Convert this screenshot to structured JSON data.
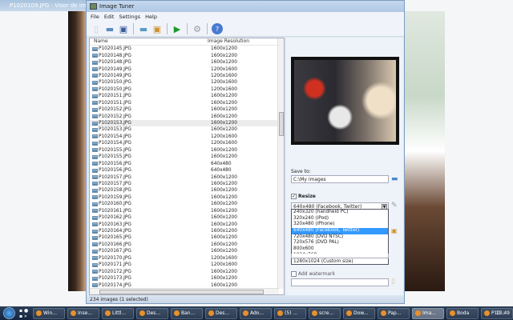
{
  "background_window": {
    "title": "P1020109.JPG - Visor de imágenes"
  },
  "window": {
    "title": "Image Tuner"
  },
  "menu": [
    "File",
    "Edit",
    "Settings",
    "Help"
  ],
  "toolbar": [
    "new-icon",
    "open-folder-icon",
    "save-icon",
    "add-folder-icon",
    "add-images-icon",
    "run-icon",
    "settings-gears-icon",
    "help-icon"
  ],
  "list": {
    "columns": [
      "Name",
      "Image Resolution"
    ],
    "rows": [
      [
        "P1020145.JPG",
        "1600x1200"
      ],
      [
        "P1020148.JPG",
        "1600x1200"
      ],
      [
        "P1020148.JPG",
        "1600x1200"
      ],
      [
        "P1020149.JPG",
        "1200x1600"
      ],
      [
        "P1020149.JPG",
        "1200x1600"
      ],
      [
        "P1020150.JPG",
        "1200x1600"
      ],
      [
        "P1020150.JPG",
        "1200x1600"
      ],
      [
        "P1020151.JPG",
        "1600x1200"
      ],
      [
        "P1020151.JPG",
        "1600x1200"
      ],
      [
        "P1020152.JPG",
        "1600x1200"
      ],
      [
        "P1020152.JPG",
        "1600x1200"
      ],
      [
        "P1020153.JPG",
        "1600x1200"
      ],
      [
        "P1020153.JPG",
        "1600x1200"
      ],
      [
        "P1020154.JPG",
        "1200x1600"
      ],
      [
        "P1020154.JPG",
        "1200x1600"
      ],
      [
        "P1020155.JPG",
        "1600x1200"
      ],
      [
        "P1020155.JPG",
        "1600x1200"
      ],
      [
        "P1020156.JPG",
        "640x480"
      ],
      [
        "P1020156.JPG",
        "640x480"
      ],
      [
        "P1020157.JPG",
        "1600x1200"
      ],
      [
        "P1020157.JPG",
        "1600x1200"
      ],
      [
        "P1020158.JPG",
        "1600x1200"
      ],
      [
        "P1020159.JPG",
        "1600x1200"
      ],
      [
        "P1020160.JPG",
        "1600x1200"
      ],
      [
        "P1020161.JPG",
        "1600x1200"
      ],
      [
        "P1020162.JPG",
        "1600x1200"
      ],
      [
        "P1020163.JPG",
        "1600x1200"
      ],
      [
        "P1020164.JPG",
        "1600x1200"
      ],
      [
        "P1020165.JPG",
        "1600x1200"
      ],
      [
        "P1020166.JPG",
        "1600x1200"
      ],
      [
        "P1020167.JPG",
        "1600x1200"
      ],
      [
        "P1020170.JPG",
        "1200x1600"
      ],
      [
        "P1020171.JPG",
        "1200x1600"
      ],
      [
        "P1020172.JPG",
        "1600x1200"
      ],
      [
        "P1020173.JPG",
        "1600x1200"
      ],
      [
        "P1020174.JPG",
        "1600x1200"
      ]
    ],
    "selected_index": 11
  },
  "status": "234 images (1 selected)",
  "panel": {
    "save_to_label": "Save to:",
    "save_to_value": "C:\\My images",
    "resize_label": "Resize",
    "resize_checked": true,
    "resize_selected": "640x480 (Facebook, Twitter)",
    "resize_options": [
      "240x320 (handheld PC)",
      "320x240 (iPod)",
      "320x480 (iPhone)",
      "640x480 (Facebook, Twitter)",
      "720x480 (DVD NTSC)",
      "720x576 (DVD PAL)",
      "800x600",
      "1024x768",
      "1280x1024 (Custom size)"
    ],
    "watermark_label": "Add watermark",
    "watermark_checked": false,
    "watermark_value": ""
  },
  "taskbar": {
    "items": [
      "Win...",
      "Inse...",
      "Littl...",
      "Des...",
      "Ban...",
      "Des...",
      "Ado...",
      "(5) ...",
      "scre...",
      "Dow...",
      "Pap...",
      "Ima...",
      "Boda",
      "P10..."
    ],
    "active_index": 11,
    "clock": "13:49"
  }
}
